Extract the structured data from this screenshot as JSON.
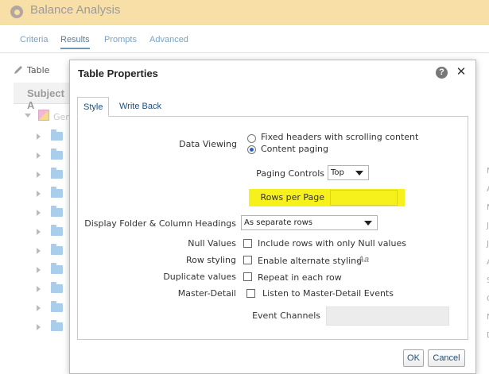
{
  "app": {
    "title": "Balance Analysis",
    "tabs": [
      {
        "label": "Criteria"
      },
      {
        "label": "Results"
      },
      {
        "label": "Prompts"
      },
      {
        "label": "Advanced"
      }
    ],
    "toolbar_label": "Table",
    "subject_label": "Subject A",
    "tree_root_label": "Gen",
    "right_letters": [
      "M",
      "A",
      "M",
      "J",
      "J",
      "A",
      "S",
      "O",
      "N",
      "D"
    ]
  },
  "dialog": {
    "title": "Table Properties",
    "help_glyph": "?",
    "close_glyph": "✕",
    "tabs": [
      {
        "label": "Style",
        "active": true
      },
      {
        "label": "Write Back",
        "active": false
      }
    ],
    "data_viewing": {
      "label": "Data Viewing",
      "options": [
        {
          "label": "Fixed headers with scrolling content",
          "checked": false
        },
        {
          "label": "Content paging",
          "checked": true
        }
      ]
    },
    "paging_controls": {
      "label": "Paging Controls",
      "value": "Top"
    },
    "rows_per_page": {
      "label": "Rows per Page",
      "value": ""
    },
    "folder_headings": {
      "label": "Display Folder & Column Headings",
      "value": "As separate rows"
    },
    "null_values": {
      "label": "Null Values",
      "option": "Include rows with only Null values",
      "checked": false
    },
    "row_styling": {
      "label": "Row styling",
      "option": "Enable alternate styling",
      "checked": false,
      "icon_text": "Aa"
    },
    "duplicate_values": {
      "label": "Duplicate values",
      "option": "Repeat in each row",
      "checked": false
    },
    "master_detail": {
      "label": "Master-Detail",
      "option": "Listen to Master-Detail Events",
      "checked": false
    },
    "event_channels": {
      "label": "Event Channels",
      "value": ""
    },
    "buttons": {
      "ok": "OK",
      "cancel": "Cancel"
    }
  },
  "colors": {
    "header_bg": "#f8dfa8",
    "highlight": "#f6f01c",
    "link": "#1d4f7c"
  }
}
